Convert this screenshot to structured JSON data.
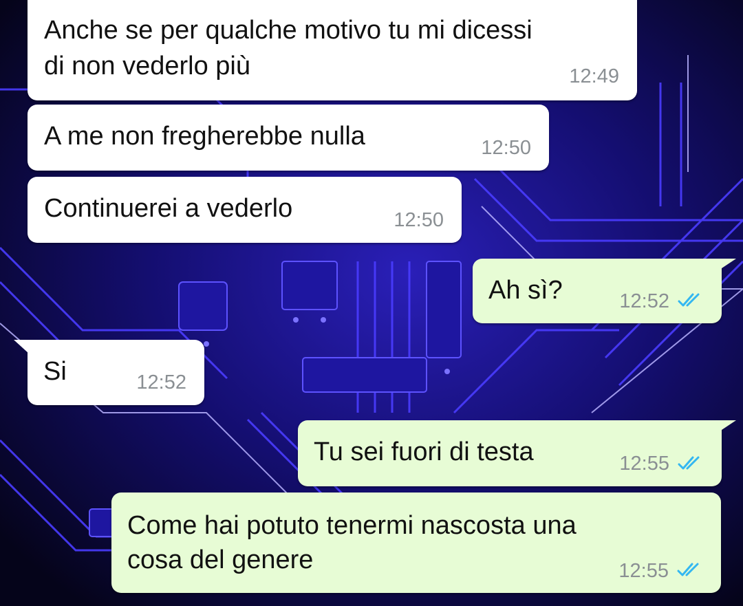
{
  "colors": {
    "incoming_bubble": "#ffffff",
    "outgoing_bubble": "#e7fcd5",
    "time_text": "#8a8f93",
    "read_ticks": "#34b7f1",
    "wallpaper_base": "#05041a",
    "wallpaper_traces": "#3b2dff"
  },
  "wallpaper": {
    "description_icon": "circuit-board-wallpaper"
  },
  "messages": [
    {
      "direction": "in",
      "line1": "Anche se per qualche motivo tu mi dicessi",
      "line2": "di non vederlo più",
      "time": "12:49"
    },
    {
      "direction": "in",
      "line1": "A me non fregherebbe nulla",
      "time": "12:50"
    },
    {
      "direction": "in",
      "line1": "Continuerei a vederlo",
      "time": "12:50"
    },
    {
      "direction": "out",
      "line1": "Ah sì?",
      "time": "12:52",
      "status": "read"
    },
    {
      "direction": "in",
      "line1": "Si",
      "time": "12:52"
    },
    {
      "direction": "out",
      "line1": "Tu sei fuori di testa",
      "time": "12:55",
      "status": "read"
    },
    {
      "direction": "out",
      "line1": "Come hai potuto tenermi nascosta una",
      "line2": "cosa del genere",
      "time": "12:55",
      "status": "read"
    }
  ]
}
